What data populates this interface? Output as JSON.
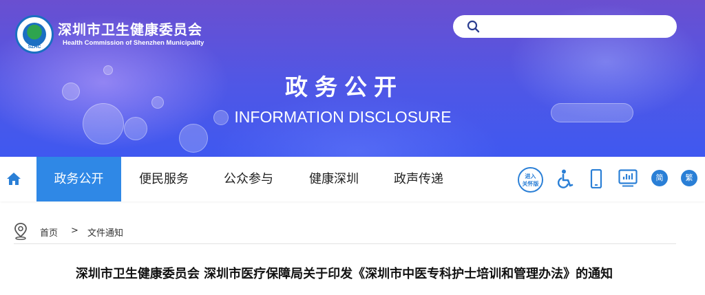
{
  "header": {
    "org_name_cn": "深圳市卫生健康委员会",
    "org_name_en": "Health Commission of Shenzhen Municipality",
    "logo_text": "SZHC",
    "search_placeholder": ""
  },
  "banner": {
    "title_cn": "政务公开",
    "title_en": "INFORMATION DISCLOSURE"
  },
  "nav": {
    "home_icon": "home-icon",
    "items": [
      {
        "label": "政务公开",
        "active": true
      },
      {
        "label": "便民服务",
        "active": false
      },
      {
        "label": "公众参与",
        "active": false
      },
      {
        "label": "健康深圳",
        "active": false
      },
      {
        "label": "政声传递",
        "active": false
      }
    ]
  },
  "tools": {
    "care_mode_line1": "进入",
    "care_mode_line2": "关怀版",
    "accessibility_icon": "wheelchair-icon",
    "mobile_icon": "mobile-phone-icon",
    "data_icon": "monitor-chart-icon",
    "simplified": "简",
    "traditional": "繁"
  },
  "breadcrumb": {
    "home": "首页",
    "separator": ">",
    "current": "文件通知"
  },
  "article": {
    "title": "深圳市卫生健康委员会 深圳市医疗保障局关于印发《深圳市中医专科护士培训和管理办法》的通知"
  },
  "colors": {
    "accent": "#2f88e6",
    "banner_top": "#6a4fd0",
    "banner_bottom": "#3f58f0"
  }
}
